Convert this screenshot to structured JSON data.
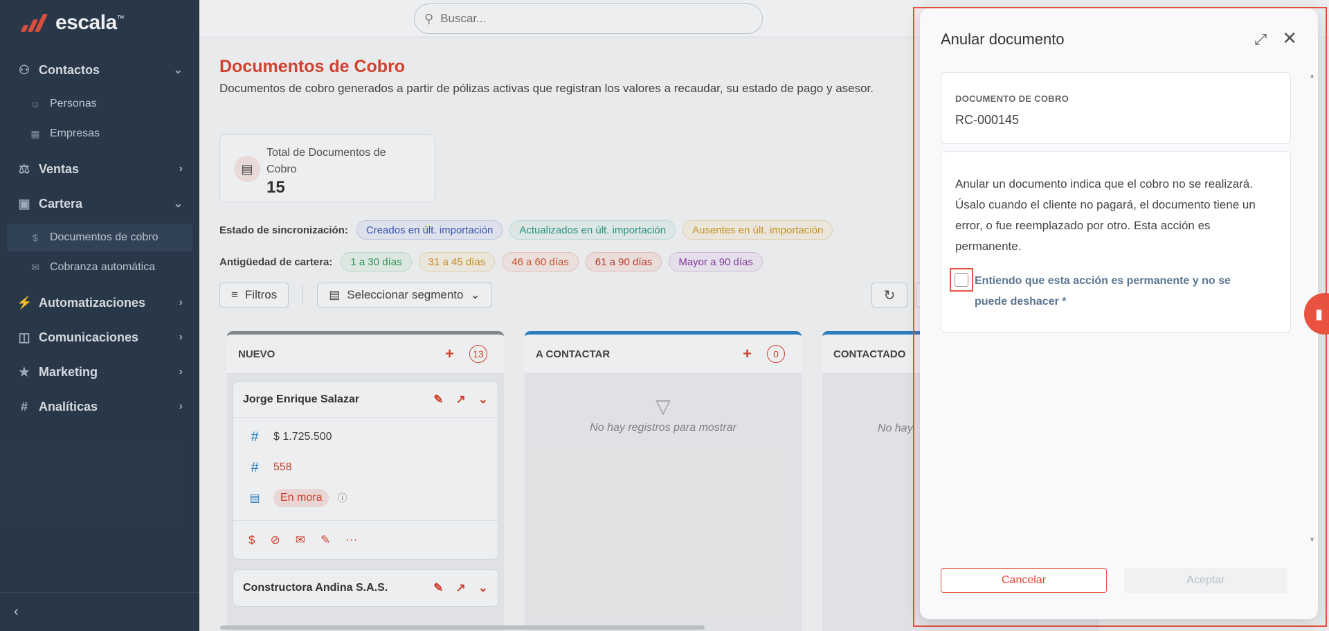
{
  "brand": {
    "name": "escala",
    "tm": "™",
    "accent": "#e8523f"
  },
  "sidebar": {
    "groups": [
      {
        "label": "Contactos",
        "icon": "users-icon",
        "expanded": true
      },
      {
        "label": "Ventas",
        "icon": "cart-icon",
        "expanded": false
      },
      {
        "label": "Cartera",
        "icon": "wallet-icon",
        "expanded": true
      },
      {
        "label": "Automatizaciones",
        "icon": "bolt-icon",
        "expanded": false
      },
      {
        "label": "Comunicaciones",
        "icon": "chat-icon",
        "expanded": false
      },
      {
        "label": "Marketing",
        "icon": "star-icon",
        "expanded": false
      },
      {
        "label": "Analíticas",
        "icon": "hash-icon",
        "expanded": false
      }
    ],
    "contactos_items": [
      "Personas",
      "Empresas"
    ],
    "cartera_items": [
      "Documentos de cobro",
      "Cobranza automática"
    ]
  },
  "search": {
    "placeholder": "Buscar..."
  },
  "page": {
    "title": "Documentos de Cobro",
    "description": "Documentos de cobro generados a partir de pólizas activas que registran los valores a recaudar, su estado de pago y asesor."
  },
  "stat": {
    "label": "Total de Documentos de Cobro",
    "value": "15"
  },
  "sync": {
    "label": "Estado de sincronización:",
    "chips": [
      "Creados en últ. importación",
      "Actualizados en últ. importación",
      "Ausentes en últ. importación"
    ]
  },
  "aging": {
    "label": "Antigüedad de cartera:",
    "chips": [
      "1 a 30 días",
      "31 a 45 días",
      "46 a 60 días",
      "61 a 90 días",
      "Mayor a 90 días"
    ]
  },
  "toolbar": {
    "filters": "Filtros",
    "segment": "Seleccionar segmento"
  },
  "columns": [
    {
      "title": "NUEVO",
      "count": "13"
    },
    {
      "title": "A CONTACTAR",
      "count": "0",
      "empty": "No hay registros para mostrar"
    },
    {
      "title": "CONTACTADO",
      "empty": "No hay"
    }
  ],
  "cards": [
    {
      "name": "Jorge Enrique Salazar",
      "amount": "$ 1.725.500",
      "number": "558",
      "status": "En mora"
    },
    {
      "name": "Constructora Andina S.A.S."
    }
  ],
  "dialog": {
    "title": "Anular documento",
    "field_caption": "DOCUMENTO DE COBRO",
    "field_value": "RC-000145",
    "message": "Anular un documento indica que el cobro no se realizará. Úsalo cuando el cliente no pagará, el documento tiene un error, o fue reemplazado por otro. Esta acción es permanente.",
    "confirm_label": "Entiendo que esta acción es permanente y no se puede deshacer *",
    "cancel": "Cancelar",
    "accept": "Aceptar"
  }
}
